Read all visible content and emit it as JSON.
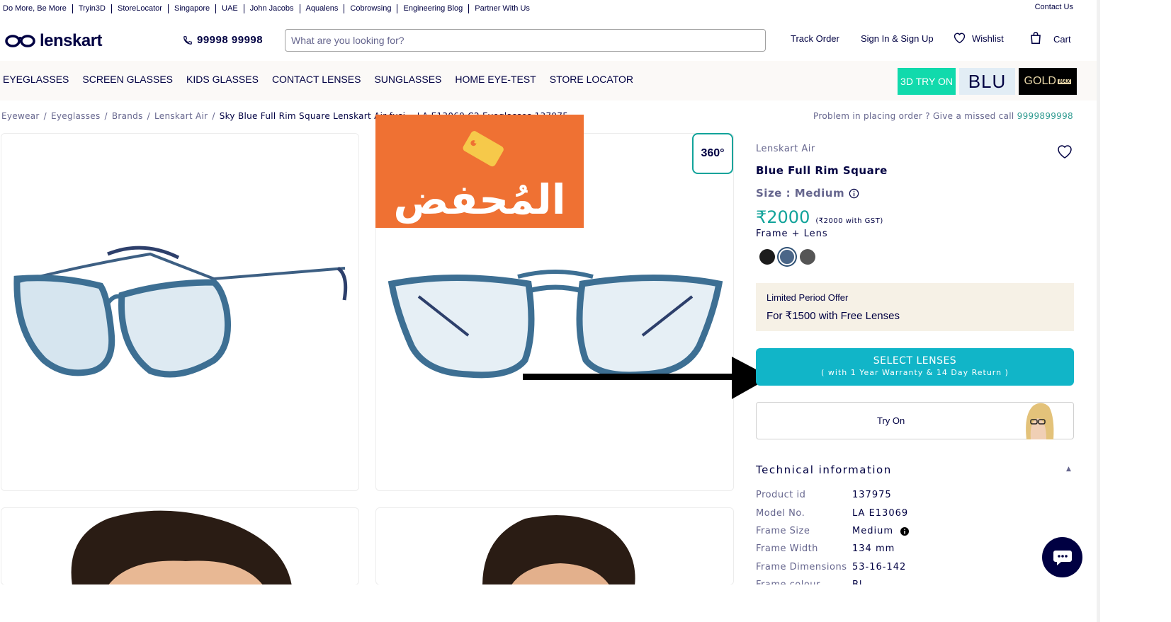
{
  "top_links": [
    "Do More, Be More",
    "Tryin3D",
    "StoreLocator",
    "Singapore",
    "UAE",
    "John Jacobs",
    "Aqualens",
    "Cobrowsing",
    "Engineering Blog",
    "Partner With Us"
  ],
  "contact_us": "Contact Us",
  "header": {
    "logo_text": "lenskart",
    "phone": "99998 99998",
    "search_placeholder": "What are you looking for?",
    "track_order": "Track Order",
    "sign_in": "Sign In & Sign Up",
    "wishlist": "Wishlist",
    "cart": "Cart"
  },
  "nav": {
    "items": [
      "EYEGLASSES",
      "SCREEN GLASSES",
      "KIDS GLASSES",
      "CONTACT LENSES",
      "SUNGLASSES",
      "HOME EYE-TEST",
      "STORE LOCATOR"
    ],
    "try3d": "3D TRY ON",
    "blu": "BLU",
    "gold": "GOLD",
    "gold_max": "MAX"
  },
  "breadcrumb": [
    "Eyewear",
    "Eyeglasses",
    "Brands",
    "Lenskart Air",
    "Sky Blue Full Rim Square Lenskart Air fusi... LA E13069 C2 Eyeglasses 137975"
  ],
  "missed_call": {
    "text": "Problem in placing order ? Give a missed call",
    "number": "9999899998"
  },
  "badge_360": "360°",
  "watermark_text": "المُحفض",
  "product": {
    "brand": "Lenskart Air",
    "name": "Blue Full Rim Square",
    "size": "Size : Medium",
    "price": "₹2000",
    "price_gst": "(₹2000 with GST)",
    "frame_lens": "Frame + Lens",
    "swatch_colors": [
      "#1c1c1c",
      "#4a6688",
      "#555555"
    ]
  },
  "offer": {
    "label": "Limited Period Offer",
    "text": "For ₹1500 with Free Lenses"
  },
  "select_lenses": {
    "title": "SELECT LENSES",
    "subtitle": "( with 1 Year Warranty & 14 Day Return )"
  },
  "try_on": "Try On",
  "technical": {
    "title": "Technical information",
    "rows": [
      {
        "label": "Product id",
        "value": "137975"
      },
      {
        "label": "Model No.",
        "value": "LA E13069"
      },
      {
        "label": "Frame Size",
        "value": "Medium"
      },
      {
        "label": "Frame Width",
        "value": "134 mm"
      },
      {
        "label": "Frame Dimensions",
        "value": "53-16-142"
      },
      {
        "label": "Frame colour",
        "value": "Bl"
      }
    ]
  },
  "colors": {
    "navy": "#000042",
    "teal": "#11b5c8",
    "price_green": "#11a39a",
    "orange": "#ef7133"
  }
}
